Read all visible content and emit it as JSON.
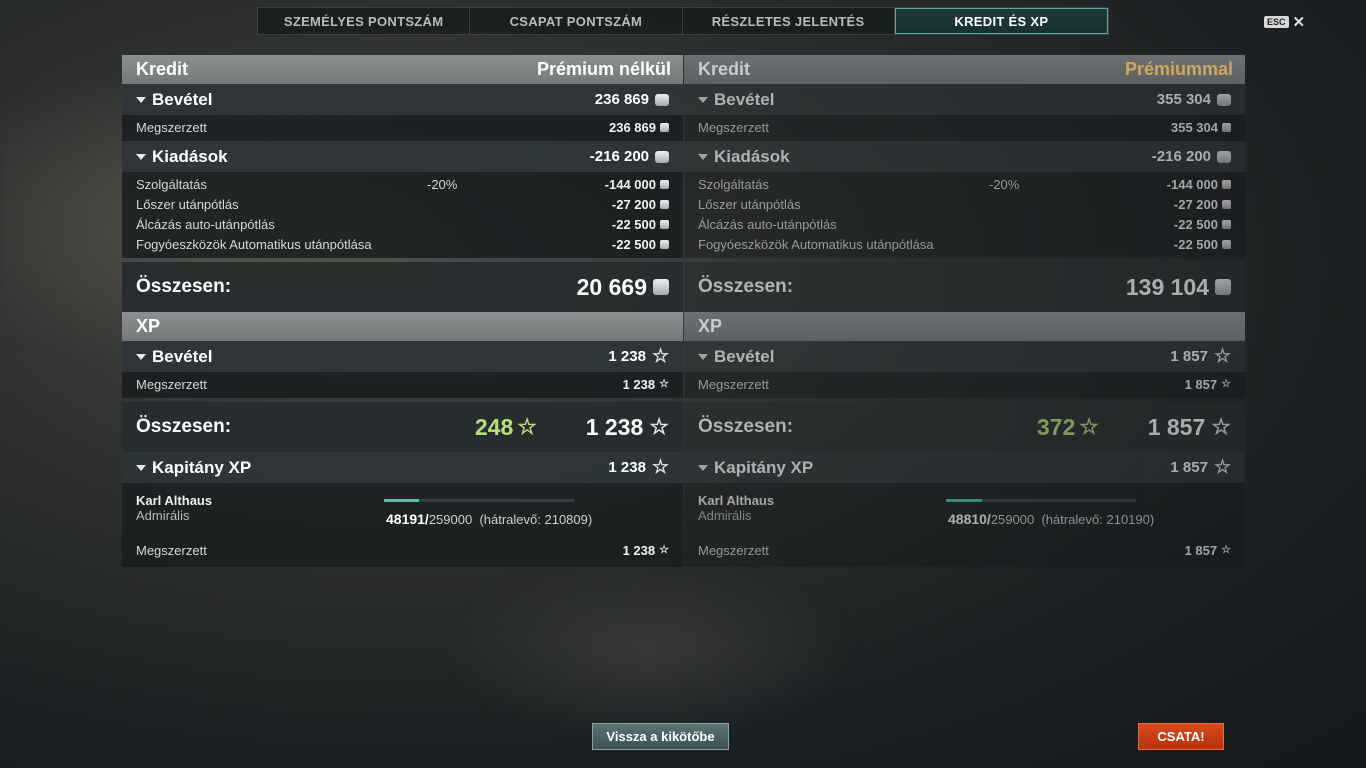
{
  "tabs": [
    {
      "label": "SZEMÉLYES PONTSZÁM"
    },
    {
      "label": "CSAPAT PONTSZÁM"
    },
    {
      "label": "RÉSZLETES JELENTÉS"
    },
    {
      "label": "KREDIT ÉS XP"
    }
  ],
  "esc": {
    "label": "ESC",
    "close": "✕"
  },
  "left": {
    "credit_title": "Kredit",
    "credit_mode": "Prémium nélkül",
    "income_label": "Bevétel",
    "income_value": "236 869",
    "earned_label": "Megszerzett",
    "earned_value": "236 869",
    "expenses_label": "Kiadások",
    "expenses_value": "-216 200",
    "expense_rows": [
      {
        "name": "Szolgáltatás",
        "pct": "-20%",
        "value": "-144 000"
      },
      {
        "name": "Lőszer utánpótlás",
        "pct": "",
        "value": "-27 200"
      },
      {
        "name": "Álcázás auto-utánpótlás",
        "pct": "",
        "value": "-22 500"
      },
      {
        "name": "Fogyóeszközök Automatikus utánpótlása",
        "pct": "",
        "value": "-22 500"
      }
    ],
    "total_label": "Összesen:",
    "credit_total": "20 669",
    "xp_title": "XP",
    "xp_income_label": "Bevétel",
    "xp_income_value": "1 238",
    "xp_earned_label": "Megszerzett",
    "xp_earned_value": "1 238",
    "xp_total_label": "Összesen:",
    "xp_bonus": "248",
    "xp_total": "1 238",
    "captain_label": "Kapitány XP",
    "captain_value": "1 238",
    "captain_name": "Karl Althaus",
    "captain_rank": "Admirális",
    "captain_xp_current": "48191/",
    "captain_xp_max": "259000",
    "captain_remaining": "(hátralevő: 210809)",
    "captain_progress": 0.186,
    "captain_earned_label": "Megszerzett",
    "captain_earned_value": "1 238"
  },
  "right": {
    "credit_title": "Kredit",
    "credit_mode": "Prémiummal",
    "income_label": "Bevétel",
    "income_value": "355 304",
    "earned_label": "Megszerzett",
    "earned_value": "355 304",
    "expenses_label": "Kiadások",
    "expenses_value": "-216 200",
    "expense_rows": [
      {
        "name": "Szolgáltatás",
        "pct": "-20%",
        "value": "-144 000"
      },
      {
        "name": "Lőszer utánpótlás",
        "pct": "",
        "value": "-27 200"
      },
      {
        "name": "Álcázás auto-utánpótlás",
        "pct": "",
        "value": "-22 500"
      },
      {
        "name": "Fogyóeszközök Automatikus utánpótlása",
        "pct": "",
        "value": "-22 500"
      }
    ],
    "total_label": "Összesen:",
    "credit_total": "139 104",
    "xp_title": "XP",
    "xp_income_label": "Bevétel",
    "xp_income_value": "1 857",
    "xp_earned_label": "Megszerzett",
    "xp_earned_value": "1 857",
    "xp_total_label": "Összesen:",
    "xp_bonus": "372",
    "xp_total": "1 857",
    "captain_label": "Kapitány XP",
    "captain_value": "1 857",
    "captain_name": "Karl Althaus",
    "captain_rank": "Admirális",
    "captain_xp_current": "48810/",
    "captain_xp_max": "259000",
    "captain_remaining": "(hátralevő: 210190)",
    "captain_progress": 0.188,
    "captain_earned_label": "Megszerzett",
    "captain_earned_value": "1 857"
  },
  "buttons": {
    "back": "Vissza a kikötőbe",
    "battle": "CSATA!"
  },
  "colors": {
    "accent": "#49c6b1",
    "premium": "#d2a761",
    "battle": "#c83c14"
  }
}
